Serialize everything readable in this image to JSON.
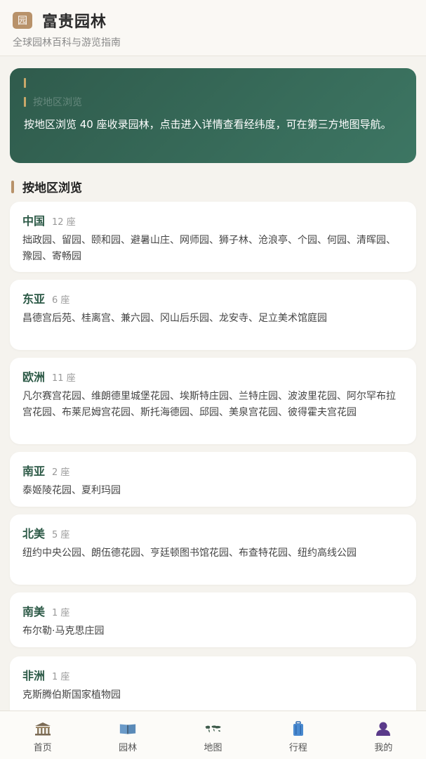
{
  "header": {
    "logo_text": "园",
    "title": "富贵园林",
    "subtitle": "全球园林百科与游览指南"
  },
  "banner": {
    "title": "按地区浏览",
    "description": "按地区浏览 40 座收录园林，点击进入详情查看经纬度，可在第三方地图导航。"
  },
  "section": {
    "title": "按地区浏览"
  },
  "regions": [
    {
      "name": "中国",
      "count": "12 座",
      "gardens": "拙政园、留园、颐和园、避暑山庄、网师园、狮子林、沧浪亭、个园、何园、清晖园、豫园、寄畅园"
    },
    {
      "name": "东亚",
      "count": "6 座",
      "gardens": "昌德宫后苑、桂离宫、兼六园、冈山后乐园、龙安寺、足立美术馆庭园"
    },
    {
      "name": "欧洲",
      "count": "11 座",
      "gardens": "凡尔赛宫花园、维朗德里城堡花园、埃斯特庄园、兰特庄园、波波里花园、阿尔罕布拉宫花园、布莱尼姆宫花园、斯托海德园、邱园、美泉宫花园、彼得霍夫宫花园"
    },
    {
      "name": "南亚",
      "count": "2 座",
      "gardens": "泰姬陵花园、夏利玛园"
    },
    {
      "name": "北美",
      "count": "5 座",
      "gardens": "纽约中央公园、朗伍德花园、亨廷顿图书馆花园、布查特花园、纽约高线公园"
    },
    {
      "name": "南美",
      "count": "1 座",
      "gardens": "布尔勒·马克思庄园"
    },
    {
      "name": "非洲",
      "count": "1 座",
      "gardens": "克斯腾伯斯国家植物园"
    }
  ],
  "tabs": [
    {
      "label": "首页",
      "icon": "home-icon"
    },
    {
      "label": "园林",
      "icon": "book-icon"
    },
    {
      "label": "地图",
      "icon": "map-icon"
    },
    {
      "label": "行程",
      "icon": "luggage-icon"
    },
    {
      "label": "我的",
      "icon": "user-icon"
    }
  ],
  "colors": {
    "accent_green": "#2f5b4c",
    "accent_gold": "#b8926a",
    "background": "#f5f3ee"
  }
}
